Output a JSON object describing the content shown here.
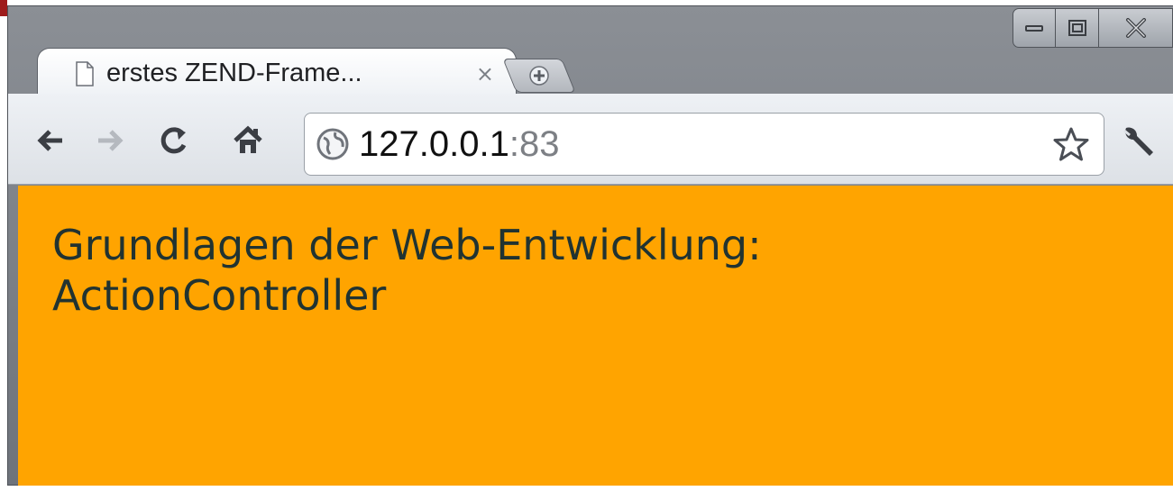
{
  "tab": {
    "title": "erstes ZEND-Frame...",
    "close_glyph": "×",
    "favicon": "page-icon"
  },
  "toolbar": {
    "back_icon": "back-arrow-icon",
    "forward_icon": "forward-arrow-icon",
    "reload_icon": "reload-icon",
    "home_icon": "home-icon",
    "bookmark_icon": "star-icon",
    "menu_icon": "wrench-icon"
  },
  "address_bar": {
    "host": "127.0.0.1",
    "port": ":83",
    "security_icon": "globe-icon"
  },
  "window_controls": {
    "minimize_icon": "minimize-icon",
    "maximize_icon": "maximize-icon",
    "close_icon": "close-icon"
  },
  "page": {
    "heading_line1": "Grundlagen der Web-Entwicklung:",
    "heading_line2": "ActionController",
    "background_color": "#ffa400",
    "text_color": "#213331"
  }
}
